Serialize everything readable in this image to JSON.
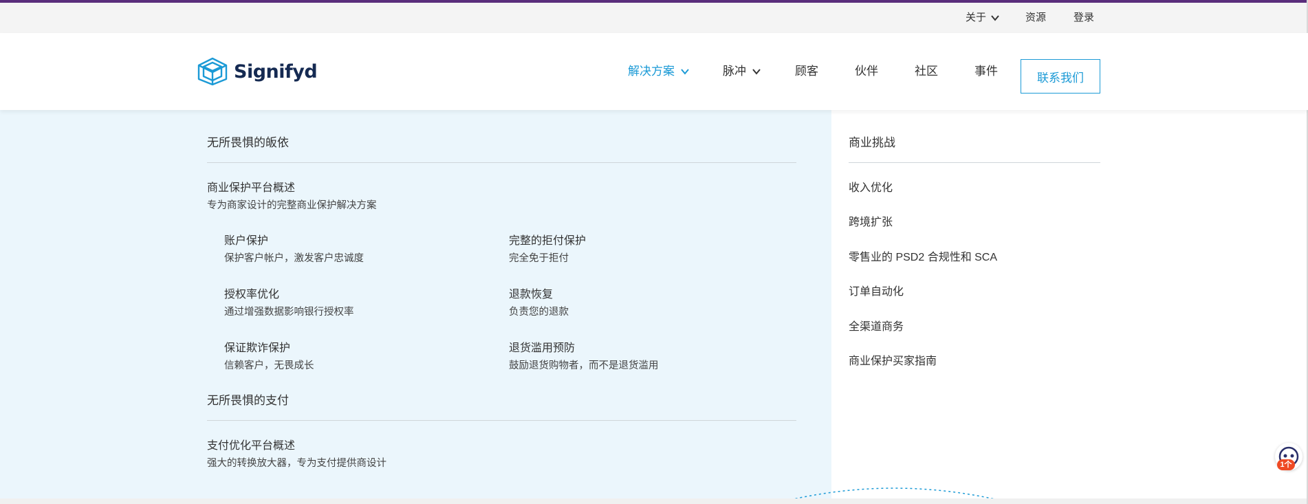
{
  "utility_nav": {
    "about": "关于",
    "resources": "资源",
    "login": "登录"
  },
  "brand": {
    "name": "Signifyd",
    "logo_color": "#1b9ad6",
    "text_color": "#152a52"
  },
  "main_nav": {
    "solutions": "解决方案",
    "pulse": "脉冲",
    "customers": "顾客",
    "partners": "伙伴",
    "community": "社区",
    "events": "事件",
    "contact": "联系我们"
  },
  "colors": {
    "accent_bar": "#5a2e7c",
    "active": "#1b9ad6",
    "panel_bg": "#ebf6fc"
  },
  "dropdown": {
    "section1": {
      "title": "无所畏惧的皈依",
      "overview_title": "商业保护平台概述",
      "overview_desc": "专为商家设计的完整商业保护解决方案",
      "items": [
        {
          "title": "账户保护",
          "desc": "保护客户帐户，激发客户忠诚度"
        },
        {
          "title": "完整的拒付保护",
          "desc": "完全免于拒付"
        },
        {
          "title": "授权率优化",
          "desc": "通过增强数据影响银行授权率"
        },
        {
          "title": "退款恢复",
          "desc": "负责您的退款"
        },
        {
          "title": "保证欺诈保护",
          "desc": "信赖客户，无畏成长"
        },
        {
          "title": "退货滥用预防",
          "desc": "鼓励退货购物者，而不是退货滥用"
        }
      ]
    },
    "section2": {
      "title": "无所畏惧的支付",
      "overview_title": "支付优化平台概述",
      "overview_desc": "强大的转换放大器，专为支付提供商设计"
    },
    "challenges": {
      "title": "商业挑战",
      "links": [
        "收入优化",
        "跨境扩张",
        "零售业的 PSD2 合规性和 SCA",
        "订单自动化",
        "全渠道商务",
        "商业保护买家指南"
      ]
    }
  },
  "help_widget": {
    "badge": "1个"
  }
}
